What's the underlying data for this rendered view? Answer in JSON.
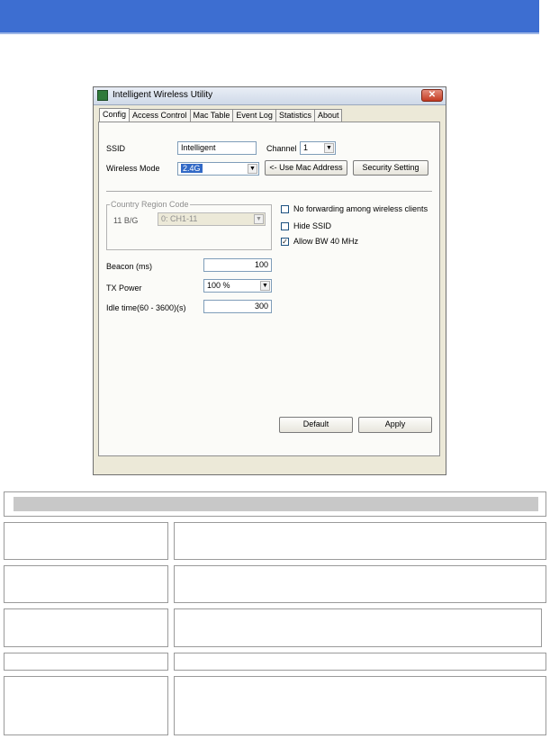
{
  "window": {
    "title": "Intelligent Wireless Utility",
    "close_glyph": "✕"
  },
  "tabs": [
    {
      "label": "Config",
      "active": true
    },
    {
      "label": "Access Control",
      "active": false
    },
    {
      "label": "Mac Table",
      "active": false
    },
    {
      "label": "Event Log",
      "active": false
    },
    {
      "label": "Statistics",
      "active": false
    },
    {
      "label": "About",
      "active": false
    }
  ],
  "config": {
    "ssid_label": "SSID",
    "ssid_value": "Intelligent",
    "channel_label": "Channel",
    "channel_value": "1",
    "wireless_mode_label": "Wireless Mode",
    "wireless_mode_value": "2.4G",
    "use_mac_button": "<- Use Mac Address",
    "security_button": "Security Setting",
    "country_group_title": "Country Region Code",
    "country_band_label": "11 B/G",
    "country_value": "0: CH1-11",
    "no_forwarding_label": "No forwarding among wireless clients",
    "no_forwarding_checked": false,
    "hide_ssid_label": "Hide SSID",
    "hide_ssid_checked": false,
    "allow_bw_label": "Allow BW 40 MHz",
    "allow_bw_checked": true,
    "beacon_label": "Beacon (ms)",
    "beacon_value": "100",
    "tx_power_label": "TX Power",
    "tx_power_value": "100 %",
    "idle_label": "Idle time(60 - 3600)(s)",
    "idle_value": "300",
    "default_button": "Default",
    "apply_button": "Apply"
  },
  "icons": {
    "dropdown_arrow": "▼",
    "check_mark": "✓"
  },
  "colors": {
    "banner": "#3d6ed1",
    "selection": "#3169c6"
  }
}
